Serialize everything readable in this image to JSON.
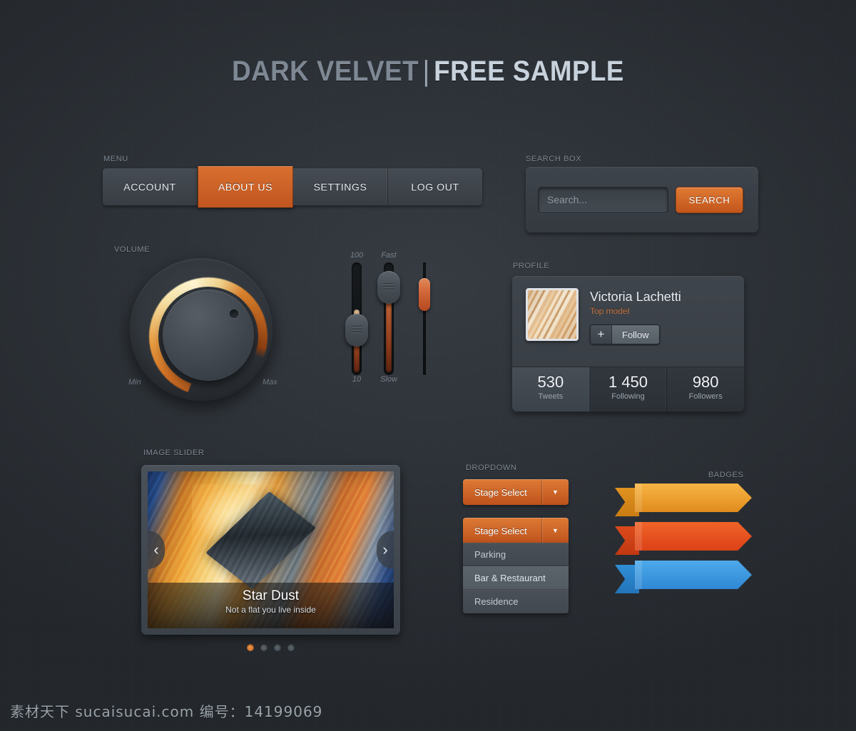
{
  "page": {
    "title_dark": "DARK VELVET",
    "title_separator": "|",
    "title_light": "FREE SAMPLE",
    "background_color": "#2b2f35",
    "accent_color": "#d4622a"
  },
  "menu": {
    "label": "MENU",
    "items": [
      {
        "label": "ACCOUNT",
        "active": false
      },
      {
        "label": "ABOUT US",
        "active": true
      },
      {
        "label": "SETTINGS",
        "active": false
      },
      {
        "label": "LOG OUT",
        "active": false
      }
    ]
  },
  "search": {
    "label": "SEARCH BOX",
    "placeholder": "Search...",
    "value": "",
    "button_label": "SEARCH"
  },
  "volume": {
    "label": "VOLUME",
    "min_label": "Min",
    "max_label": "Max"
  },
  "sliders": [
    {
      "top_label": "100",
      "bottom_label": "10",
      "value_pct": 45
    },
    {
      "top_label": "Fast",
      "bottom_label": "Slow",
      "value_pct": 78
    },
    {
      "top_label": "",
      "bottom_label": "",
      "value_pct": 80
    }
  ],
  "profile": {
    "label": "PROFILE",
    "name": "Victoria Lachetti",
    "role": "Top model",
    "follow_plus": "+",
    "follow_label": "Follow",
    "stats": [
      {
        "value": "530",
        "label": "Tweets",
        "active": true
      },
      {
        "value": "1 450",
        "label": "Following",
        "active": false
      },
      {
        "value": "980",
        "label": "Followers",
        "active": false
      }
    ]
  },
  "image_slider": {
    "label": "IMAGE SLIDER",
    "slide_title": "Star Dust",
    "slide_subtitle": "Not a flat you live inside",
    "prev_icon": "‹",
    "next_icon": "›",
    "dots": [
      {
        "active": true
      },
      {
        "active": false
      },
      {
        "active": false
      },
      {
        "active": false
      }
    ]
  },
  "dropdown": {
    "label": "DROPDOWN",
    "closed_value": "Stage Select",
    "open_value": "Stage Select",
    "caret_icon": "▼",
    "options": [
      {
        "label": "Parking",
        "hovered": false
      },
      {
        "label": "Bar & Restaurant",
        "hovered": true
      },
      {
        "label": "Residence",
        "hovered": false
      }
    ]
  },
  "badges": {
    "label": "BADGES",
    "items": [
      {
        "color_light": "#f7b23f",
        "color_dark": "#e08c1d",
        "tail": "#d87f18"
      },
      {
        "color_light": "#ef5f27",
        "color_dark": "#dc4117",
        "tail": "#cf3b14"
      },
      {
        "color_light": "#4aa5e8",
        "color_dark": "#2f87d4",
        "tail": "#2a7cc4"
      }
    ]
  },
  "watermark": {
    "text": "素材天下 sucaisucai.com 编号：14199069"
  }
}
